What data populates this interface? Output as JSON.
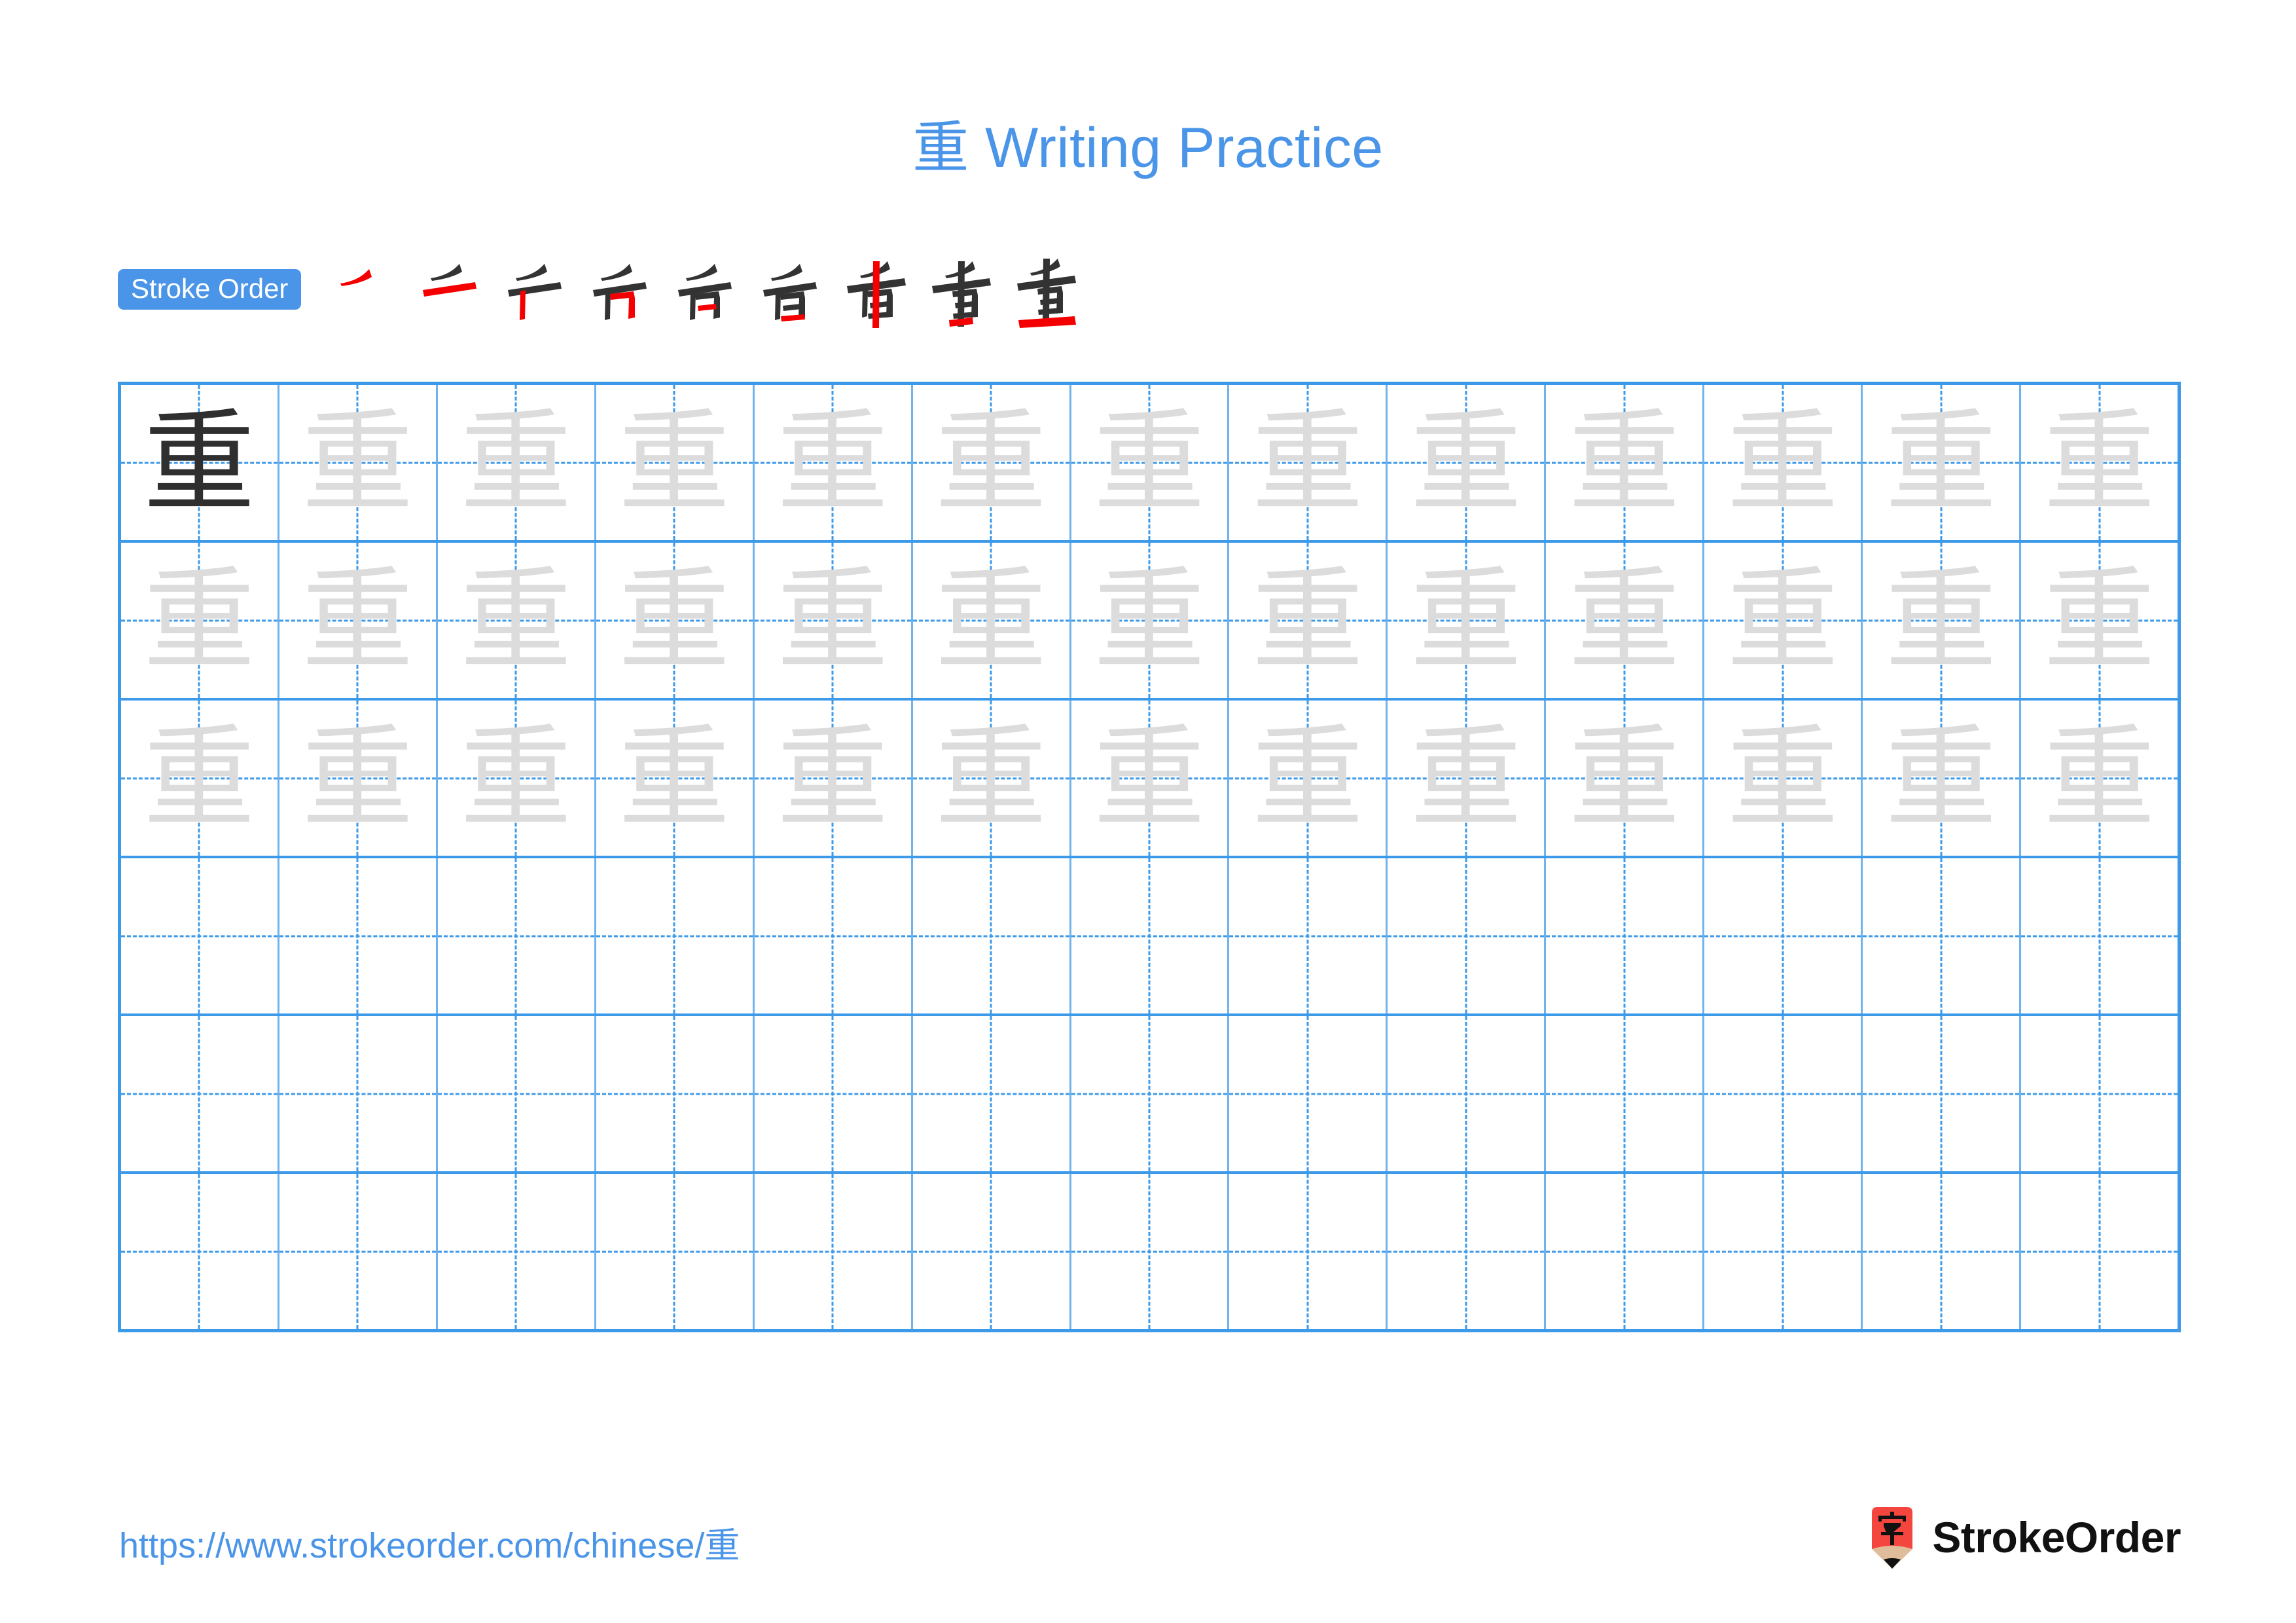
{
  "page": {
    "character": "重",
    "title": "重 Writing Practice",
    "title_character": "重",
    "title_text": " Writing Practice"
  },
  "stroke_order": {
    "badge_label": "Stroke Order",
    "total_strokes": 9,
    "steps": [
      {
        "index": 1,
        "glyph": "丿",
        "new_stroke": "piě (left-falling)",
        "highlight_color": "#f40000"
      },
      {
        "index": 2,
        "glyph": "𠂉",
        "new_stroke": "héng (horizontal)",
        "highlight_color": "#f40000"
      },
      {
        "index": 3,
        "glyph": "亻",
        "new_stroke": "shù (vertical)",
        "highlight_color": "#f40000"
      },
      {
        "index": 4,
        "glyph": "𠂉口",
        "new_stroke": "héngzhé (horizontal-turn)",
        "highlight_color": "#f40000"
      },
      {
        "index": 5,
        "glyph": "自",
        "new_stroke": "héng (horizontal)",
        "highlight_color": "#f40000"
      },
      {
        "index": 6,
        "glyph": "自",
        "new_stroke": "héng (horizontal)",
        "highlight_color": "#f40000"
      },
      {
        "index": 7,
        "glyph": "重",
        "new_stroke": "shù (long vertical)",
        "highlight_color": "#f40000"
      },
      {
        "index": 8,
        "glyph": "重",
        "new_stroke": "héng (horizontal)",
        "highlight_color": "#f40000"
      },
      {
        "index": 9,
        "glyph": "重",
        "new_stroke": "héng (bottom horizontal)",
        "highlight_color": "#f40000"
      }
    ],
    "ink_color": "#333333"
  },
  "practice_grid": {
    "columns": 13,
    "rows": 6,
    "grid_line_color": "#3d9ae8",
    "guide_line_color": "#3d9ae8",
    "dark_char_color": "#2f2f2f",
    "trace_char_color": "#dcdcdc",
    "row_fill": [
      {
        "row": 1,
        "filled_cells": 13,
        "first_cell_dark": true
      },
      {
        "row": 2,
        "filled_cells": 13,
        "first_cell_dark": false
      },
      {
        "row": 3,
        "filled_cells": 13,
        "first_cell_dark": false
      },
      {
        "row": 4,
        "filled_cells": 0,
        "first_cell_dark": false
      },
      {
        "row": 5,
        "filled_cells": 0,
        "first_cell_dark": false
      },
      {
        "row": 6,
        "filled_cells": 0,
        "first_cell_dark": false
      }
    ]
  },
  "footer": {
    "url": "https://www.strokeorder.com/chinese/重",
    "brand_name": "StrokeOrder",
    "logo_character": "字",
    "logo_body_color": "#f4463f",
    "logo_wood_color": "#e0bd9a",
    "logo_tip_color": "#111111",
    "url_color": "#4a95e8"
  },
  "colors": {
    "accent_blue": "#4a95e8",
    "grid_blue": "#3d9ae8",
    "stroke_red": "#f40000",
    "ink_black": "#333333",
    "trace_gray": "#dcdcdc"
  }
}
